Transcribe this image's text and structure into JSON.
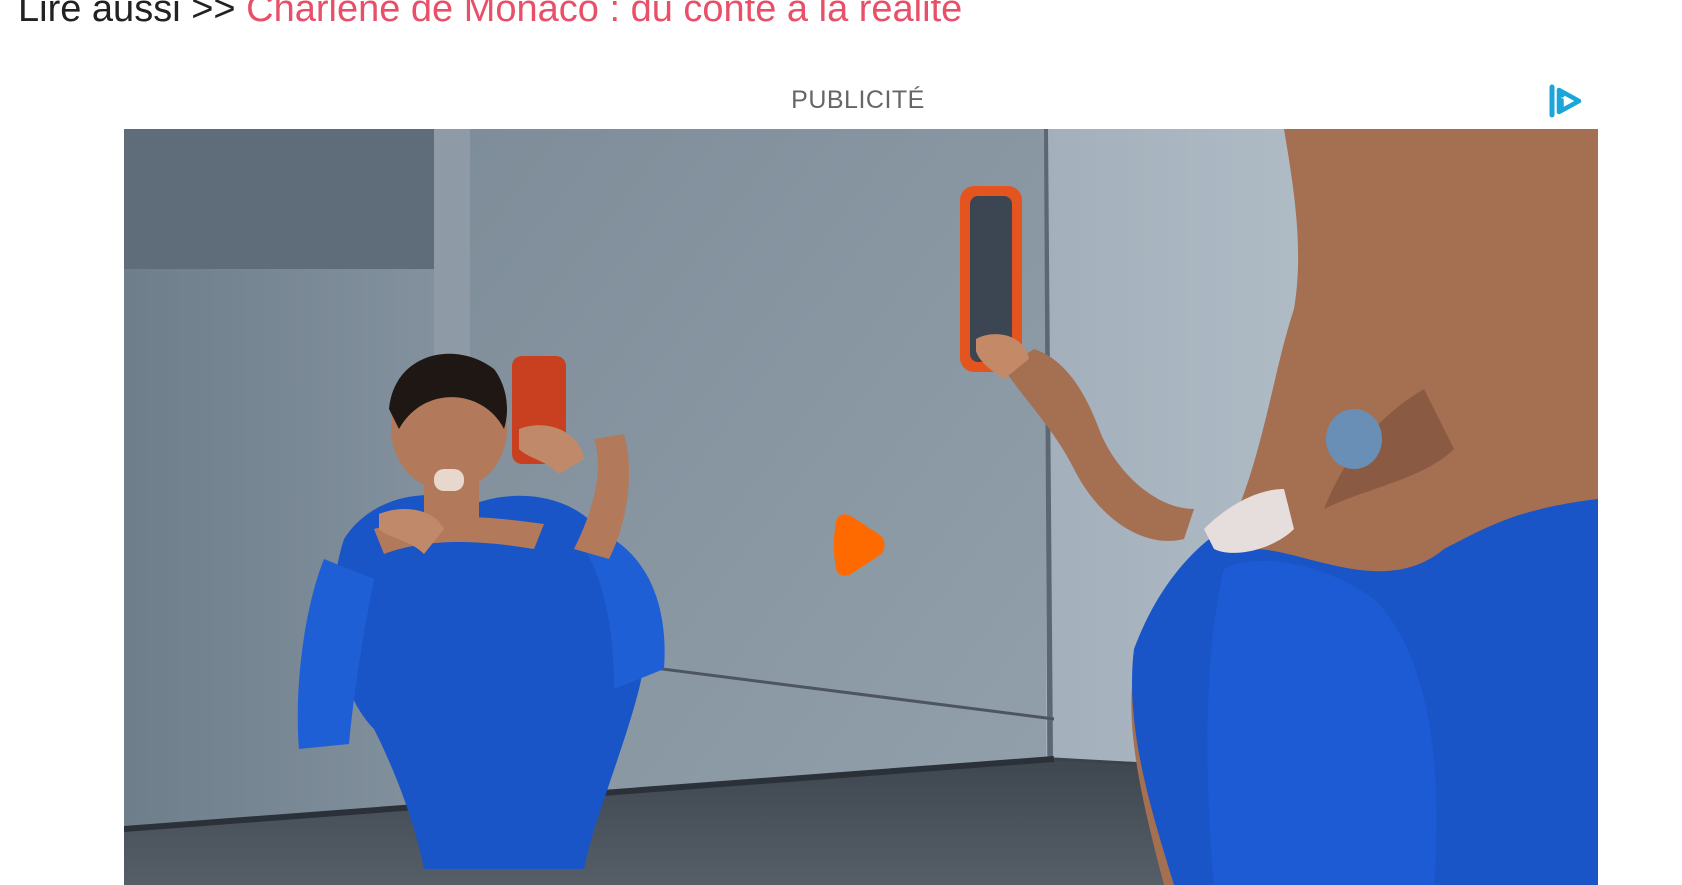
{
  "article": {
    "read_also_prefix": "Lire aussi >> ",
    "read_also_link": "Charlène de Monaco : du conte à la réalité"
  },
  "ad": {
    "label": "PUBLICITÉ",
    "badge_icon": "ad-choices-icon"
  },
  "video": {
    "play_icon": "play-icon"
  },
  "colors": {
    "link": "#e8506a",
    "text": "#222222",
    "ad_label": "#666666",
    "play": "#ff6a00",
    "badge": "#1ba6d9",
    "dress": "#1a55c8"
  }
}
